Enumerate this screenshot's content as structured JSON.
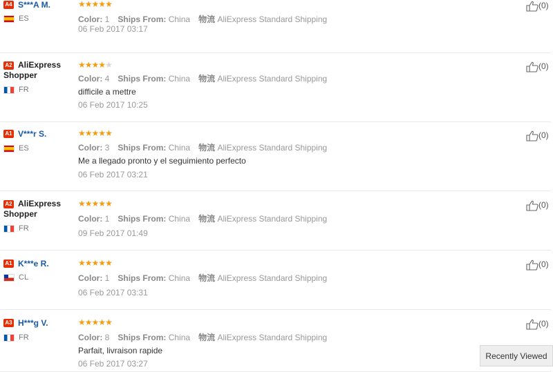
{
  "reviews": [
    {
      "badge": "A4",
      "name": "S***A M.",
      "name_style": "blue",
      "country": "ES",
      "flag": "es",
      "stars": 5,
      "color": "1",
      "ships_from": "China",
      "logistics": "AliExpress Standard Shipping",
      "text": "",
      "date": "06 Feb 2017 03:17",
      "helpful": "(0)"
    },
    {
      "badge": "A2",
      "name": "AliExpress Shopper",
      "name_style": "dark",
      "country": "FR",
      "flag": "fr",
      "stars": 4,
      "color": "4",
      "ships_from": "China",
      "logistics": "AliExpress Standard Shipping",
      "text": "difficile a mettre",
      "date": "06 Feb 2017 10:25",
      "helpful": "(0)"
    },
    {
      "badge": "A1",
      "name": "V***r S.",
      "name_style": "blue",
      "country": "ES",
      "flag": "es",
      "stars": 5,
      "color": "3",
      "ships_from": "China",
      "logistics": "AliExpress Standard Shipping",
      "text": "Me a llegado pronto y el seguimiento perfecto",
      "date": "06 Feb 2017 03:21",
      "helpful": "(0)"
    },
    {
      "badge": "A2",
      "name": "AliExpress Shopper",
      "name_style": "dark",
      "country": "FR",
      "flag": "fr",
      "stars": 5,
      "color": "1",
      "ships_from": "China",
      "logistics": "AliExpress Standard Shipping",
      "text": "",
      "date": "09 Feb 2017 01:49",
      "helpful": "(0)"
    },
    {
      "badge": "A1",
      "name": "K***e R.",
      "name_style": "blue",
      "country": "CL",
      "flag": "cl",
      "stars": 5,
      "color": "1",
      "ships_from": "China",
      "logistics": "AliExpress Standard Shipping",
      "text": "",
      "date": "06 Feb 2017 03:31",
      "helpful": "(0)"
    },
    {
      "badge": "A3",
      "name": "H***g V.",
      "name_style": "blue",
      "country": "FR",
      "flag": "fr",
      "stars": 5,
      "color": "8",
      "ships_from": "China",
      "logistics": "AliExpress Standard Shipping",
      "text": "Parfait, livraison rapide",
      "date": "06 Feb 2017 03:27",
      "helpful": "(0)"
    }
  ],
  "labels": {
    "color": "Color:",
    "ships_from": "Ships From:",
    "logistics_prefix": "物流"
  },
  "recently_viewed": "Recently Viewed"
}
